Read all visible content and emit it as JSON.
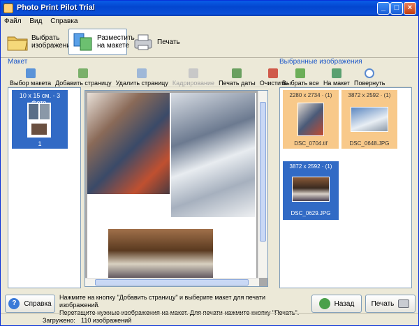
{
  "window": {
    "title": "Photo Print Pilot Trial"
  },
  "menu": [
    "Файл",
    "Вид",
    "Справка"
  ],
  "toolbar": {
    "select_images": "Выбрать\nизображения",
    "place_on_layout": "Разместить\nна макете",
    "print": "Печать"
  },
  "left": {
    "section": "Макет",
    "tools": {
      "choose_layout": "Выбор макета",
      "add_page": "Добавить страницу",
      "delete_page": "Удалить страницу",
      "crop": "Кадрирование",
      "print_dates": "Печать даты",
      "clear": "Очистить"
    },
    "layout_card": {
      "title": "10 x 15 см. - 3 фото.",
      "page_number": "1"
    }
  },
  "right": {
    "section": "Выбранные изображения",
    "tools": {
      "select_all": "Выбрать все",
      "to_layout": "На макет",
      "rotate": "Повернуть"
    },
    "images": [
      {
        "dims": "2280 x 2734 · (1)",
        "name": "DSC_0704.tif"
      },
      {
        "dims": "3872 x 2592 · (1)",
        "name": "DSC_0648.JPG"
      },
      {
        "dims": "3872 x 2592 · (1)",
        "name": "DSC_0629.JPG"
      }
    ]
  },
  "bottom": {
    "help": "Справка",
    "hint_line1": "Нажмите на кнопку \"Добавить страницу\" и выберите макет для печати изображений.",
    "hint_line2": "Перетащите нужные изображения на макет. Для печати нажмите кнопку \"Печать\".",
    "back": "Назад",
    "print": "Печать"
  },
  "status": {
    "loaded_label": "Загружено:",
    "loaded_value": "110 изображений"
  },
  "colors": {
    "title_bar": "#0a4fd8",
    "section_label": "#1b57c9",
    "selection_blue": "#316ac5",
    "selection_orange": "#f8c98a"
  }
}
